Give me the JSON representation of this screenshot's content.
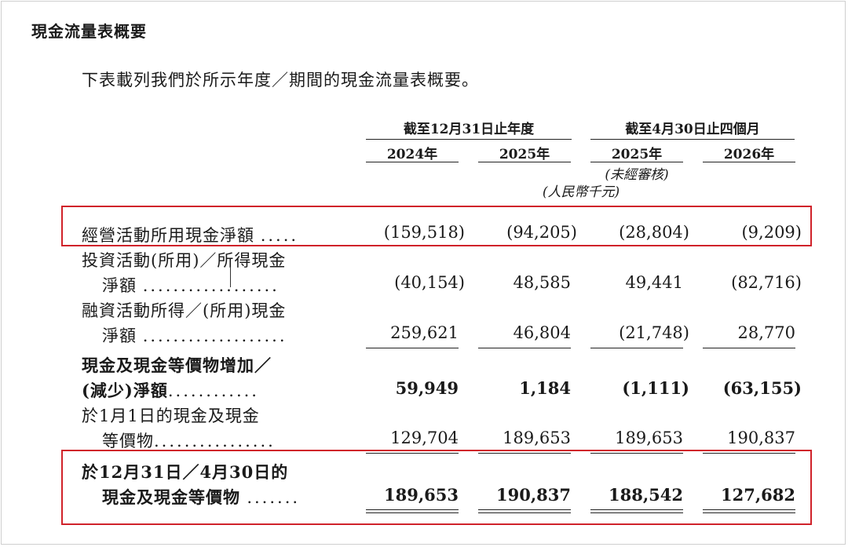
{
  "section_title": "現金流量表概要",
  "intro": "下表載列我們於所示年度／期間的現金流量表概要。",
  "header": {
    "group1": "截至12月31日止年度",
    "group2": "截至4月30日止四個月",
    "col1": "2024年",
    "col2": "2025年",
    "col3": "2025年",
    "col4": "2026年",
    "unaudited": "(未經審核)",
    "unit": "(人民幣千元)"
  },
  "rows": [
    {
      "label_line1": "經營活動所用現金淨額",
      "dots": ".....",
      "values": [
        "(159,518)",
        "(94,205)",
        "(28,804)",
        "(9,209)"
      ]
    },
    {
      "label_line1": "投資活動(所用)／所得現金",
      "label_line2": "淨額",
      "dots": "..................",
      "values": [
        "(40,154)",
        "48,585",
        "49,441",
        "(82,716)"
      ]
    },
    {
      "label_line1": "融資活動所得／(所用)現金",
      "label_line2": "淨額",
      "dots": "...................",
      "values": [
        "259,621",
        "46,804",
        "(21,748)",
        "28,770"
      ]
    },
    {
      "label_line1": "現金及現金等價物增加／",
      "label_line2": "(減少)淨額",
      "dots": "............",
      "values": [
        "59,949",
        "1,184",
        "(1,111)",
        "(63,155)"
      ]
    },
    {
      "label_line1": "於1月1日的現金及現金",
      "label_line2": "等價物",
      "dots": "................",
      "values": [
        "129,704",
        "189,653",
        "189,653",
        "190,837"
      ]
    },
    {
      "label_line1": "於12月31日／4月30日的",
      "label_line2": "現金及現金等價物",
      "dots": ".......",
      "values": [
        "189,653",
        "190,837",
        "188,542",
        "127,682"
      ]
    }
  ],
  "colors": {
    "highlight": "#d0222a",
    "text": "#1a1a1a"
  }
}
